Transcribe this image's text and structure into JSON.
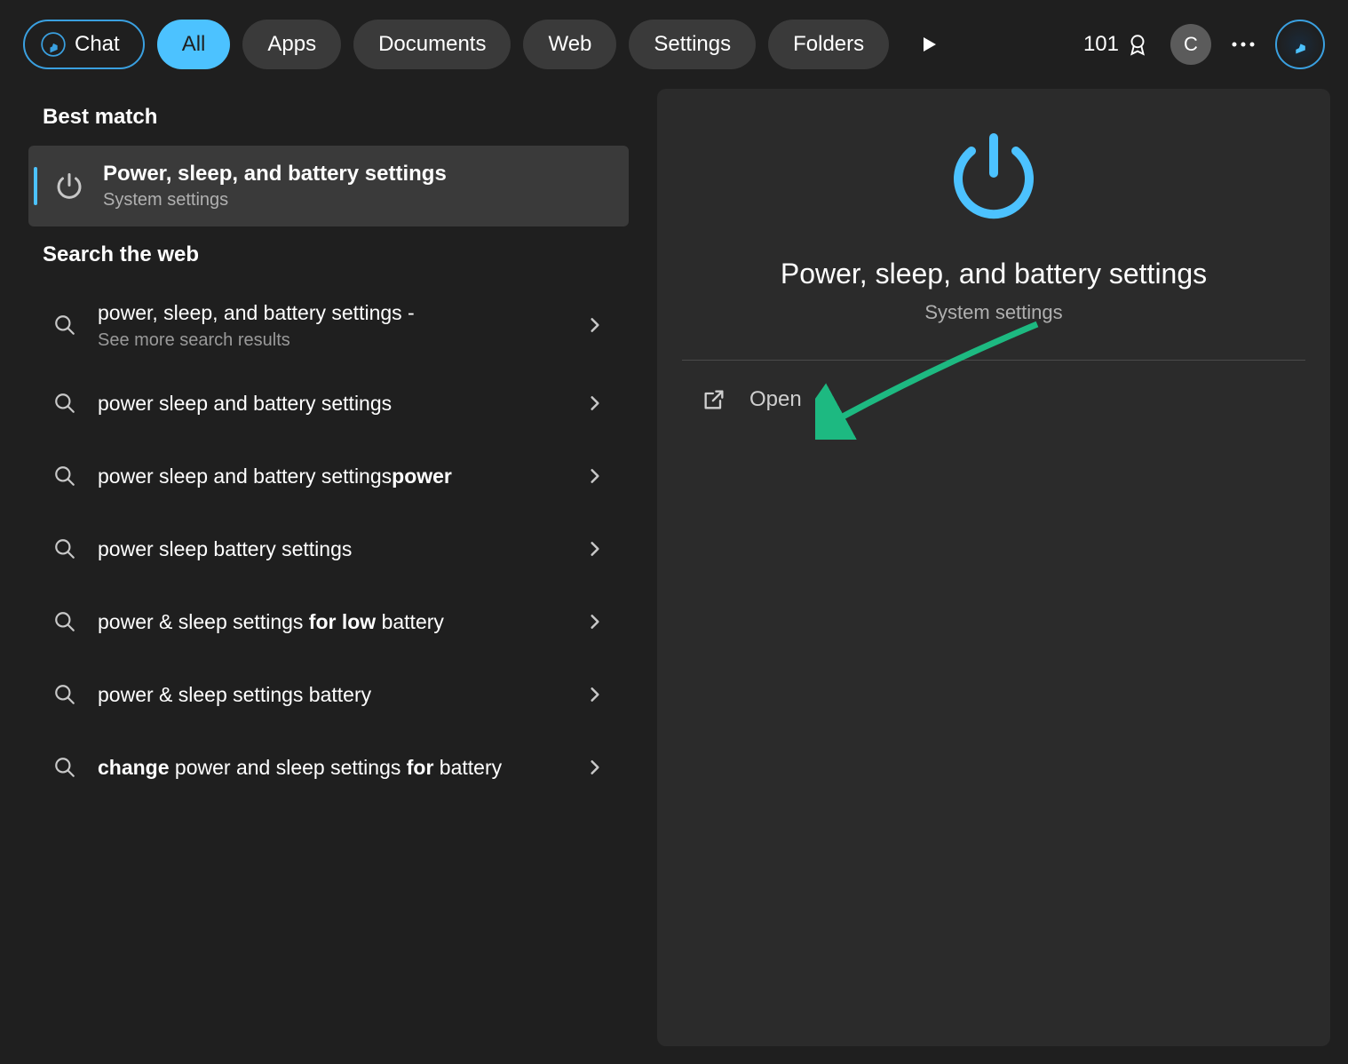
{
  "topbar": {
    "chat_label": "Chat",
    "filters": [
      {
        "label": "All",
        "active": true
      },
      {
        "label": "Apps",
        "active": false
      },
      {
        "label": "Documents",
        "active": false
      },
      {
        "label": "Web",
        "active": false
      },
      {
        "label": "Settings",
        "active": false
      },
      {
        "label": "Folders",
        "active": false
      }
    ],
    "rewards_points": "101",
    "avatar_initial": "C"
  },
  "left": {
    "best_match_header": "Best match",
    "best_match": {
      "title": "Power, sleep, and battery settings",
      "subtitle": "System settings"
    },
    "web_header": "Search the web",
    "web_results": [
      {
        "html": "power, sleep, and battery settings -",
        "sub": "See more search results"
      },
      {
        "html": "power sleep and battery settings",
        "sub": ""
      },
      {
        "html": "power sleep and battery settings<b>power</b>",
        "sub": ""
      },
      {
        "html": "power sleep battery settings",
        "sub": ""
      },
      {
        "html": "power & sleep settings <b>for low</b> battery",
        "sub": ""
      },
      {
        "html": "power & sleep settings battery",
        "sub": ""
      },
      {
        "html": "<b>change</b> power and sleep settings <b>for</b> battery",
        "sub": ""
      }
    ]
  },
  "detail": {
    "title": "Power, sleep, and battery settings",
    "subtitle": "System settings",
    "open_label": "Open"
  },
  "colors": {
    "accent": "#4cc2ff",
    "annotation": "#1db981"
  }
}
